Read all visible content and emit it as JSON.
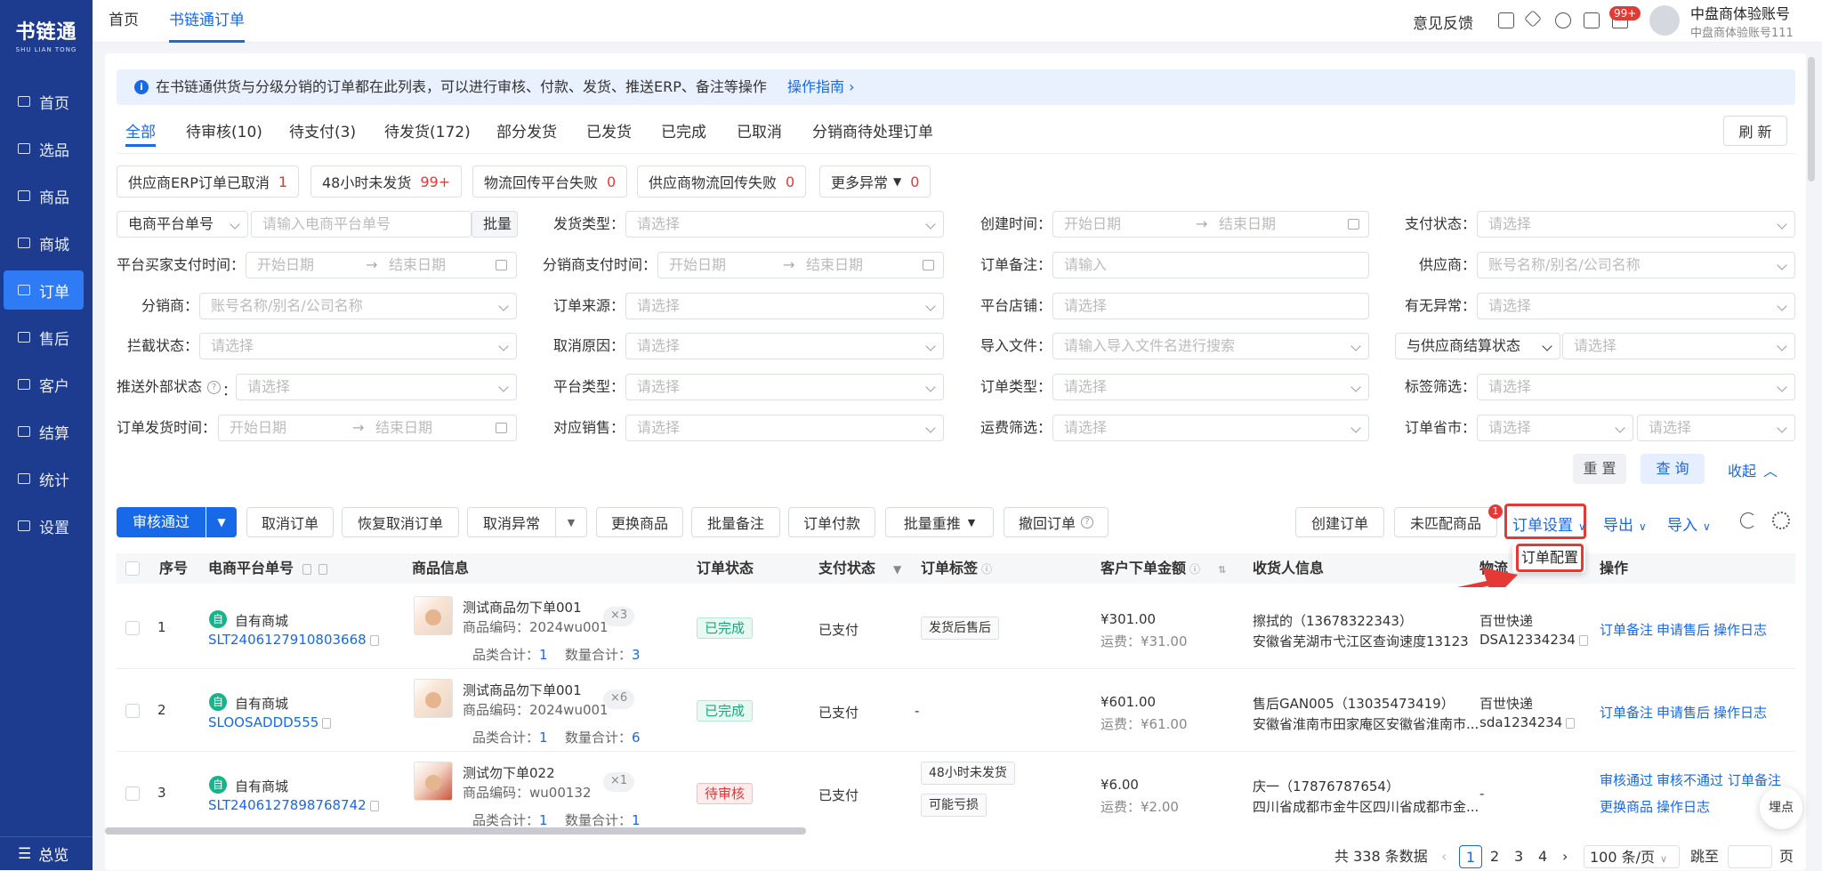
{
  "sidebar": {
    "logo_cn": "书链通",
    "logo_en": "SHU LIAN TONG",
    "items": [
      {
        "label": "首页"
      },
      {
        "label": "选品"
      },
      {
        "label": "商品"
      },
      {
        "label": "商城"
      },
      {
        "label": "订单"
      },
      {
        "label": "售后"
      },
      {
        "label": "客户"
      },
      {
        "label": "结算"
      },
      {
        "label": "统计"
      },
      {
        "label": "设置"
      }
    ],
    "bottom": "总览"
  },
  "topbar": {
    "tabs": [
      "首页",
      "书链通订单"
    ],
    "feedback": "意见反馈",
    "notif_badge": "99+",
    "account_name": "中盘商体验账号",
    "account_sub": "中盘商体验账号111"
  },
  "info": {
    "text": "在书链通供货与分级分销的订单都在此列表，可以进行审核、付款、发货、推送ERP、备注等操作",
    "guide": "操作指南 ›"
  },
  "status_tabs": [
    "全部",
    "待审核(10)",
    "待支付(3)",
    "待发货(172)",
    "部分发货",
    "已发货",
    "已完成",
    "已取消",
    "分销商待处理订单"
  ],
  "refresh": "刷 新",
  "chips": [
    {
      "label": "供应商ERP订单已取消",
      "n": "1"
    },
    {
      "label": "48小时未发货",
      "n": "99+"
    },
    {
      "label": "物流回传平台失败",
      "n": "0"
    },
    {
      "label": "供应商物流回传失败",
      "n": "0"
    },
    {
      "label": "更多异常",
      "n": "0"
    }
  ],
  "filters": {
    "ecom_no_sel": "电商平台单号",
    "ecom_no_ph": "请输入电商平台单号",
    "batch": "批量",
    "ship_type": "发货类型：",
    "create_time": "创建时间：",
    "pay_status": "支付状态：",
    "buyer_pay_time": "平台买家支付时间：",
    "dist_pay_time": "分销商支付时间：",
    "order_remark": "订单备注：",
    "supplier": "供应商：",
    "distributor": "分销商：",
    "order_source": "订单来源：",
    "platform_shop": "平台店铺：",
    "has_anomaly": "有无异常：",
    "intercept": "拦截状态：",
    "cancel_reason": "取消原因：",
    "import_file": "导入文件：",
    "settle_sel": "与供应商结算状态",
    "push_ext": "推送外部状态",
    "platform_type": "平台类型：",
    "order_type": "订单类型：",
    "tag_filter": "标签筛选：",
    "ship_time": "订单发货时间：",
    "sales": "对应销售：",
    "freight": "运费筛选：",
    "province": "订单省市：",
    "ph_select": "请选择",
    "ph_start": "开始日期",
    "ph_end": "结束日期",
    "ph_input": "请输入",
    "ph_account": "账号名称/别名/公司名称",
    "ph_import": "请输入导入文件名进行搜索",
    "reset": "重 置",
    "query": "查 询",
    "collapse": "收起"
  },
  "toolbar": {
    "approve": "审核通过",
    "cancel": "取消订单",
    "restore": "恢复取消订单",
    "cancel_anom": "取消异常",
    "replace": "更换商品",
    "batch_remark": "批量备注",
    "pay": "订单付款",
    "batch_push": "批量重推",
    "recall": "撤回订单",
    "create": "创建订单",
    "unmatched": "未匹配商品",
    "settings": "订单设置",
    "export": "导出",
    "import": "导入",
    "dropdown_item": "订单配置",
    "step": "1"
  },
  "table": {
    "headers": [
      "序号",
      "电商平台单号",
      "商品信息",
      "订单状态",
      "支付状态",
      "订单标签",
      "客户下单金额",
      "收货人信息",
      "物流",
      "操作"
    ],
    "rows": [
      {
        "idx": "1",
        "shop": "自有商城",
        "no": "SLT2406127910803668",
        "pname": "测试商品勿下单001",
        "pcode": "商品编码：2024wu001",
        "qty": "×3",
        "kinds": "品类合计：",
        "kinds_n": "1",
        "count": "数量合计：",
        "count_n": "3",
        "status": "已完成",
        "pay": "已支付",
        "tags": [
          "发货后售后"
        ],
        "amount": "¥301.00",
        "freight": "运费：¥31.00",
        "rname": "擦拭的（13678322343）",
        "raddr": "安徽省芜湖市弋江区查询速度13123",
        "carrier": "百世快递",
        "track": "DSA12334234",
        "ops": [
          "订单备注",
          "申请售后",
          "操作日志"
        ]
      },
      {
        "idx": "2",
        "shop": "自有商城",
        "no": "SLOOSADDD555",
        "pname": "测试商品勿下单001",
        "pcode": "商品编码：2024wu001",
        "qty": "×6",
        "kinds": "品类合计：",
        "kinds_n": "1",
        "count": "数量合计：",
        "count_n": "6",
        "status": "已完成",
        "pay": "已支付",
        "tags": [
          "-"
        ],
        "amount": "¥601.00",
        "freight": "运费：¥61.00",
        "rname": "售后GAN005（13035473419）",
        "raddr": "安徽省淮南市田家庵区安徽省淮南市...",
        "carrier": "百世快递",
        "track": "sda1234234",
        "ops": [
          "订单备注",
          "申请售后",
          "操作日志"
        ]
      },
      {
        "idx": "3",
        "shop": "自有商城",
        "no": "SLT2406127898768742",
        "pname": "测试勿下单022",
        "pcode": "商品编码：wu00132",
        "qty": "×1",
        "kinds": "品类合计：",
        "kinds_n": "1",
        "count": "数量合计：",
        "count_n": "1",
        "status": "待审核",
        "pay": "已支付",
        "tags": [
          "48小时未发货",
          "可能亏损"
        ],
        "amount": "¥6.00",
        "freight": "运费：¥2.00",
        "rname": "庆一（17876787654）",
        "raddr": "四川省成都市金牛区四川省成都市金...",
        "carrier": "-",
        "track": "",
        "ops": [
          "审核通过",
          "审核不通过",
          "订单备注",
          "更换商品",
          "操作日志"
        ]
      }
    ]
  },
  "pagination": {
    "total": "共 338 条数据",
    "pages": [
      "1",
      "2",
      "3",
      "4"
    ],
    "size": "100 条/页",
    "jump": "跳至",
    "page": "页"
  },
  "float_btn": "埋点",
  "colors": {
    "primary": "#1769e8",
    "sidebar": "#1d3c8f",
    "highlight": "#e53935"
  }
}
